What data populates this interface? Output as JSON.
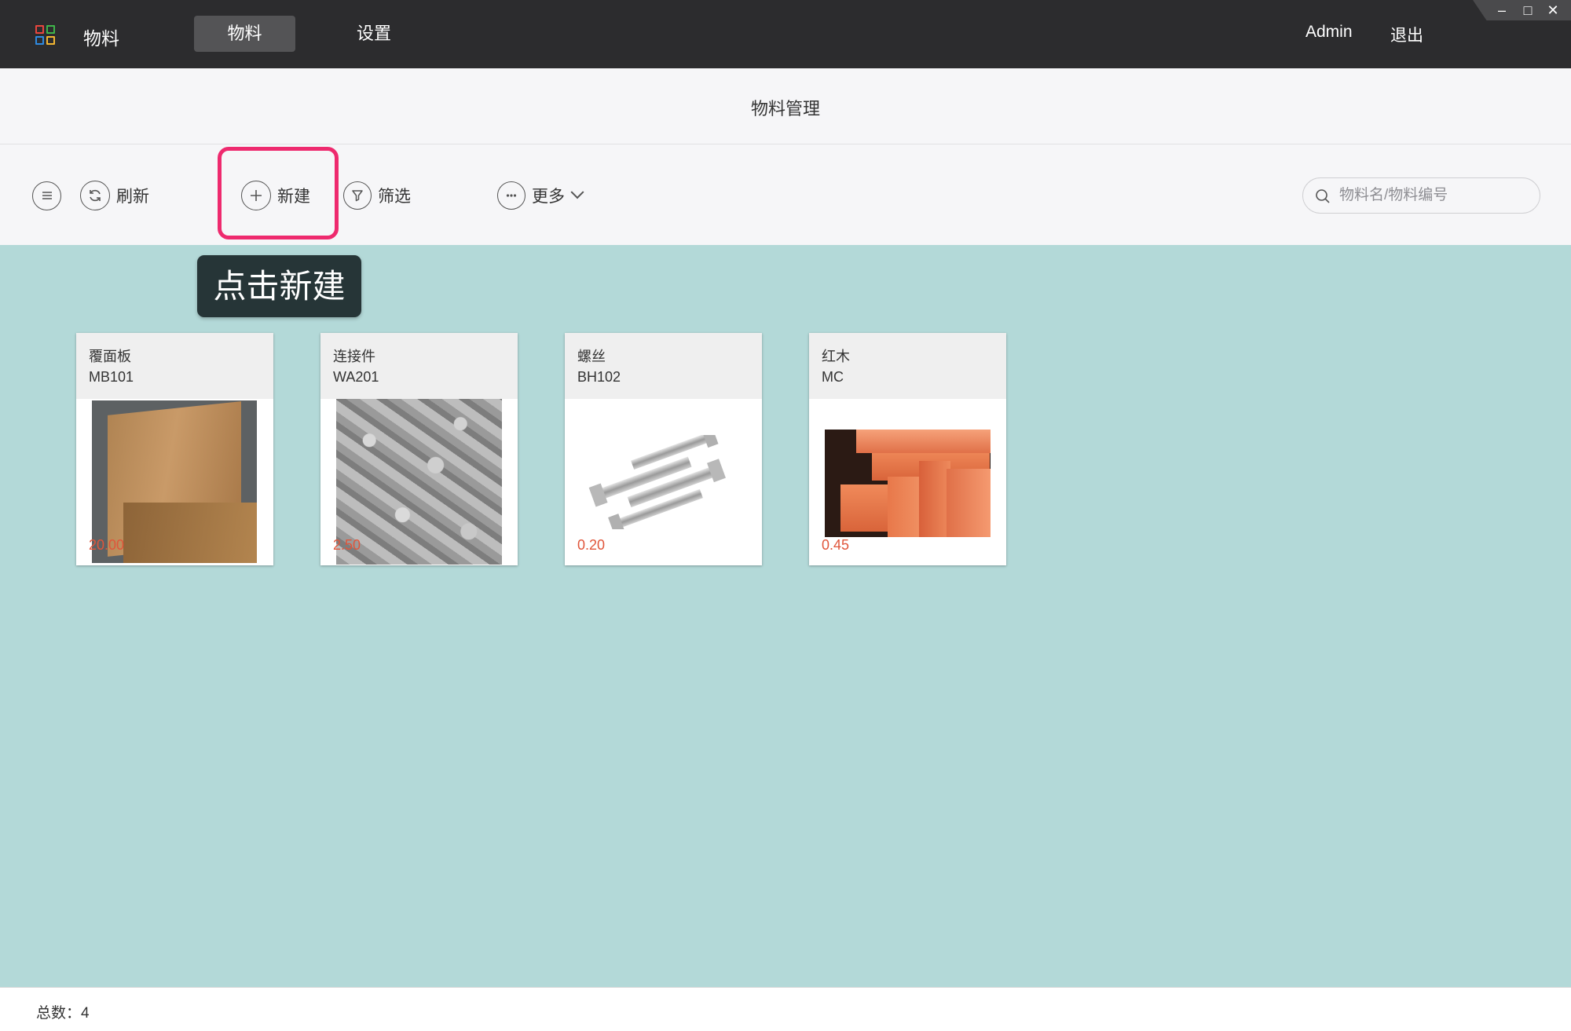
{
  "window": {
    "app_name": "物料",
    "colors": {
      "topbar": "#2c2c2e",
      "active_tab": "#545456",
      "highlight": "#ee2a6e",
      "main_bg": "#b3d9d8",
      "price": "#e0553a"
    }
  },
  "nav": {
    "tabs": [
      {
        "label": "物料",
        "active": true
      },
      {
        "label": "设置",
        "active": false
      }
    ]
  },
  "user": {
    "name": "Admin",
    "logout_label": "退出"
  },
  "window_controls": {
    "minimize": "–",
    "maximize": "□",
    "close": "✕"
  },
  "page": {
    "title": "物料管理"
  },
  "toolbar": {
    "menu_icon": "list-icon",
    "refresh_label": "刷新",
    "new_label": "新建",
    "filter_label": "筛选",
    "more_label": "更多",
    "more_chevron": "∨"
  },
  "search": {
    "placeholder": "物料名/物料编号",
    "value": ""
  },
  "tooltip": {
    "text": "点击新建"
  },
  "materials": [
    {
      "name": "覆面板",
      "code": "MB101",
      "price": "20.00",
      "image": "wood-panel"
    },
    {
      "name": "连接件",
      "code": "WA201",
      "price": "2.50",
      "image": "connectors"
    },
    {
      "name": "螺丝",
      "code": "BH102",
      "price": "0.20",
      "image": "bolts"
    },
    {
      "name": "红木",
      "code": "MC",
      "price": "0.45",
      "image": "redwood"
    }
  ],
  "footer": {
    "total_label": "总数：4"
  }
}
